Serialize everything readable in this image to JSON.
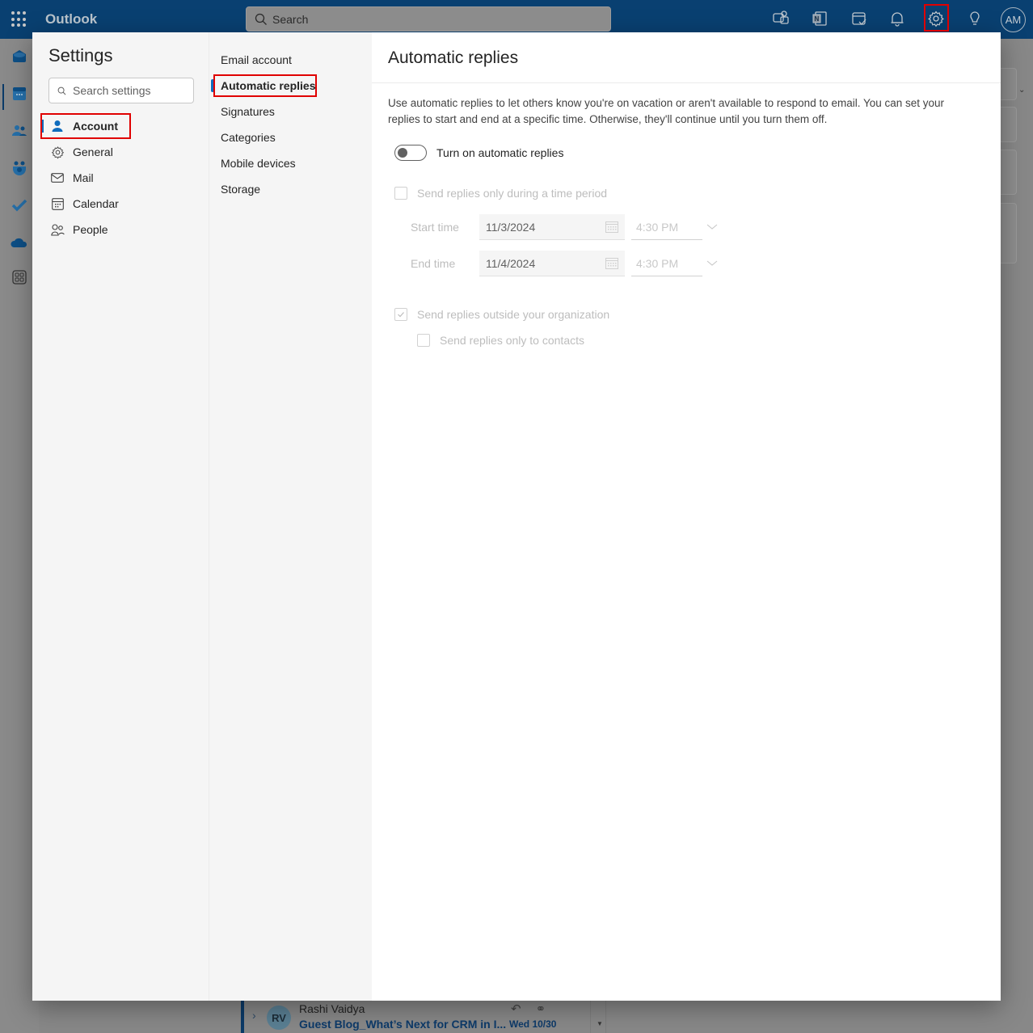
{
  "app": {
    "name": "Outlook",
    "search_placeholder": "Search",
    "avatar_initials": "AM",
    "accent_color": "#0f6cbd",
    "highlight_color": "#e00000"
  },
  "topbar_icons": [
    "teams-chat-icon",
    "onenote-icon",
    "my-day-icon",
    "notifications-bell-icon",
    "settings-gear-icon",
    "tips-lightbulb-icon"
  ],
  "rail_icons": [
    "mail-icon",
    "calendar-icon",
    "people-icon",
    "groups-icon",
    "todo-check-icon",
    "onedrive-cloud-icon",
    "more-apps-icon"
  ],
  "settings": {
    "title": "Settings",
    "search_placeholder": "Search settings",
    "categories": [
      {
        "label": "Account",
        "icon": "person-icon",
        "active": true
      },
      {
        "label": "General",
        "icon": "gear-icon",
        "active": false
      },
      {
        "label": "Mail",
        "icon": "mail-icon",
        "active": false
      },
      {
        "label": "Calendar",
        "icon": "calendar-icon",
        "active": false
      },
      {
        "label": "People",
        "icon": "people-icon",
        "active": false
      }
    ],
    "subcategories": [
      {
        "label": "Email account",
        "active": false
      },
      {
        "label": "Automatic replies",
        "active": true
      },
      {
        "label": "Signatures",
        "active": false
      },
      {
        "label": "Categories",
        "active": false
      },
      {
        "label": "Mobile devices",
        "active": false
      },
      {
        "label": "Storage",
        "active": false
      }
    ]
  },
  "pane": {
    "title": "Automatic replies",
    "description": "Use automatic replies to let others know you're on vacation or aren't available to respond to email. You can set your replies to start and end at a specific time. Otherwise, they'll continue until you turn them off.",
    "toggle": {
      "label": "Turn on automatic replies",
      "on": false
    },
    "time_period": {
      "label": "Send replies only during a time period",
      "checked": false,
      "disabled": true
    },
    "start": {
      "label": "Start time",
      "date": "11/3/2024",
      "time": "4:30 PM"
    },
    "end": {
      "label": "End time",
      "date": "11/4/2024",
      "time": "4:30 PM"
    },
    "outside_org": {
      "label": "Send replies outside your organization",
      "checked": true,
      "disabled": true
    },
    "contacts_only": {
      "label": "Send replies only to contacts",
      "checked": false,
      "disabled": true
    }
  },
  "background_message": {
    "initials": "RV",
    "from": "Rashi Vaidya",
    "subject": "Guest Blog_What’s Next for CRM in I...",
    "date": "Wed 10/30"
  }
}
